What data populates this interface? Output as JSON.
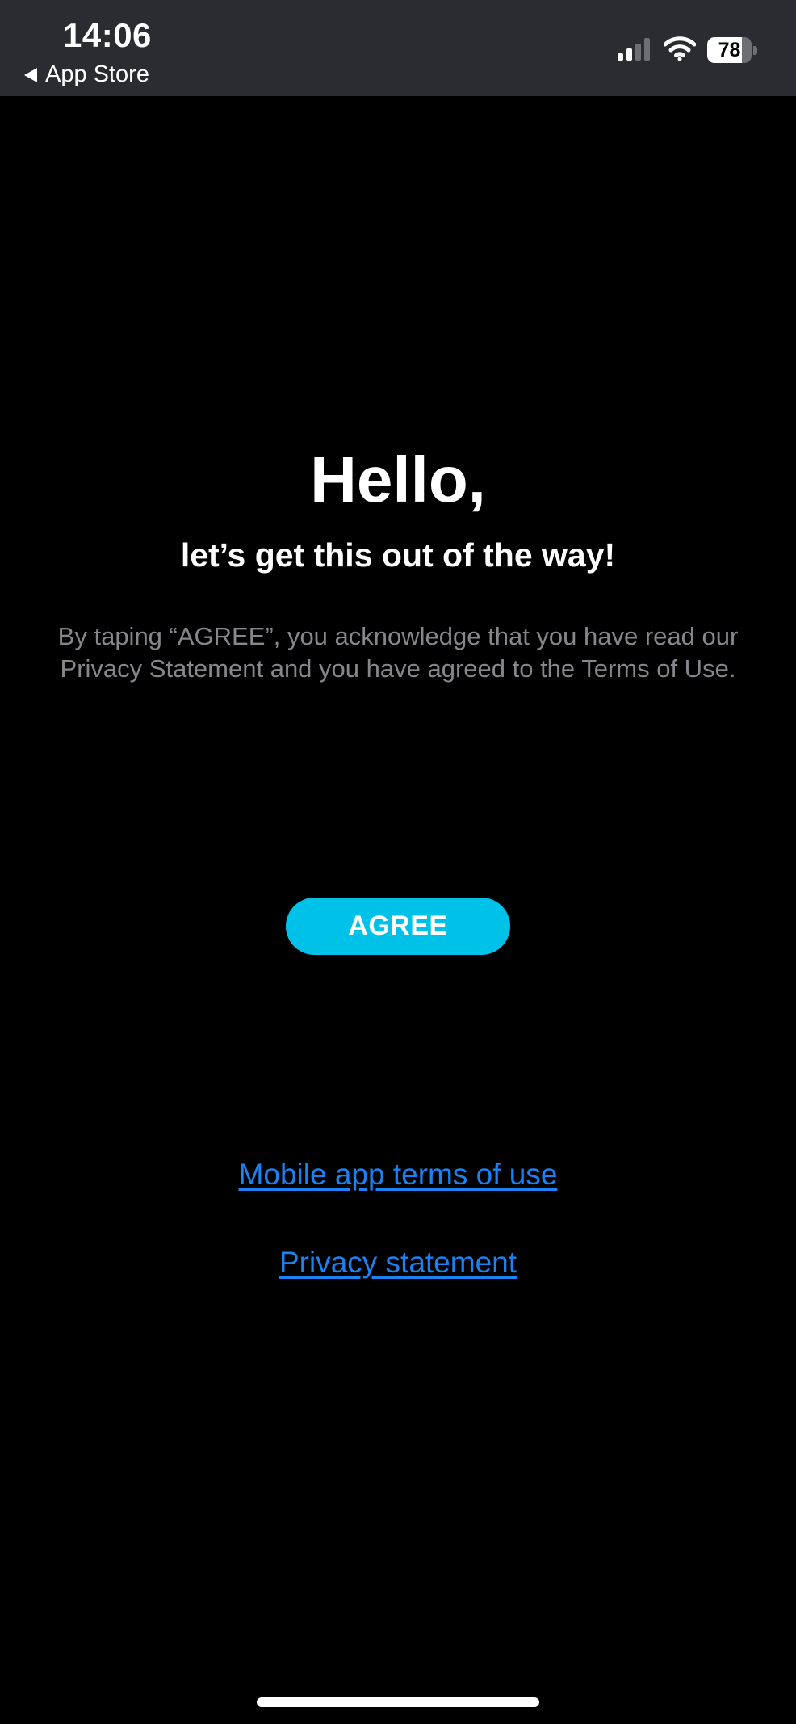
{
  "status_bar": {
    "time": "14:06",
    "back_label": "App Store",
    "battery_level": "78",
    "battery_fraction": 0.78
  },
  "content": {
    "title": "Hello,",
    "subtitle": "let’s get this out of the way!",
    "notice": "By taping “AGREE”, you acknowledge that you have read our Privacy Statement and you have agreed to the Terms of Use.",
    "agree_label": "AGREE",
    "terms_link": "Mobile app terms of use",
    "privacy_link": "Privacy statement"
  },
  "icons": {
    "back": "back-arrow-icon",
    "signal": "cellular-signal-icon",
    "wifi": "wifi-icon",
    "battery": "battery-icon"
  },
  "colors": {
    "background": "#000000",
    "status_bar": "#2b2c31",
    "accent_button": "#00c1e8",
    "link": "#1a82f2",
    "notice_text": "#86878d"
  }
}
